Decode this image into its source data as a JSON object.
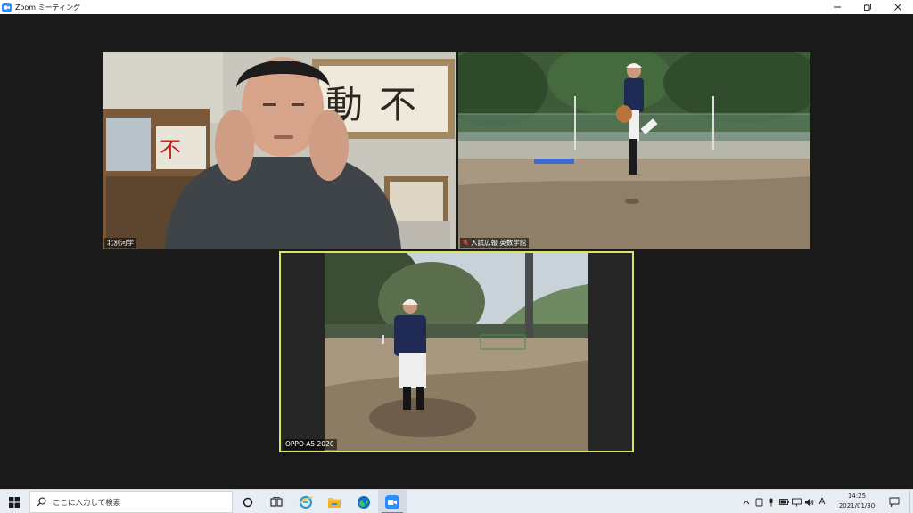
{
  "window": {
    "title": "Zoom ミーティング"
  },
  "participants": [
    {
      "name": "北別河学",
      "muted": false
    },
    {
      "name": "入試広報 英数学館",
      "muted": true
    },
    {
      "name": "OPPO A5 2020",
      "muted": false,
      "active_speaker": true
    }
  ],
  "taskbar": {
    "search_placeholder": "ここに入力して検索",
    "apps": [
      "task-view",
      "edge-legacy",
      "file-explorer",
      "edge",
      "zoom"
    ],
    "ime_indicator": "A",
    "time": "14:25",
    "date": "2021/01/30"
  },
  "colors": {
    "stage_background": "#1a1a1a",
    "active_speaker_border": "#d8e36a",
    "zoom_blue": "#2d8cff",
    "taskbar": "#e8edf3"
  }
}
